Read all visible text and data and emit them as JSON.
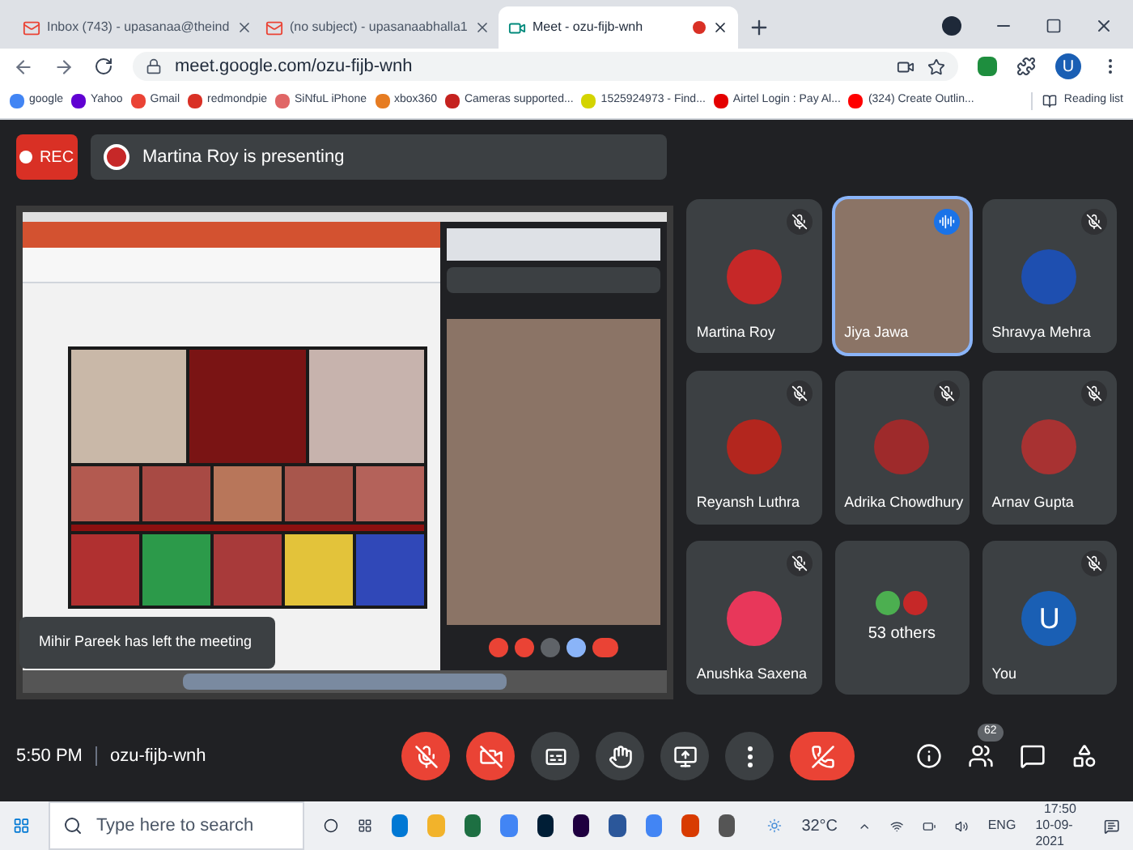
{
  "browser": {
    "tabs": [
      {
        "title": "Inbox (743) - upasanaa@theind",
        "selected": false,
        "kind": "mail"
      },
      {
        "title": "(no subject) - upasanaabhalla1",
        "selected": false,
        "kind": "mail"
      },
      {
        "title": "Meet - ozu-fijb-wnh",
        "selected": true,
        "kind": "meet",
        "recording": true
      }
    ],
    "address": "meet.google.com/ozu-fijb-wnh",
    "profile": "U",
    "bookmarks": [
      {
        "label": "google",
        "color": "#4285f4"
      },
      {
        "label": "Yahoo",
        "color": "#6001d2"
      },
      {
        "label": "Gmail",
        "color": "#ea4335"
      },
      {
        "label": "redmondpie",
        "color": "#d93025"
      },
      {
        "label": "SiNfuL iPhone",
        "color": "#e06666"
      },
      {
        "label": "xbox360",
        "color": "#e67c22"
      },
      {
        "label": "Cameras supported...",
        "color": "#c5221f"
      },
      {
        "label": "1525924973 - Find...",
        "color": "#d4d400"
      },
      {
        "label": "Airtel Login : Pay Al...",
        "color": "#e40000"
      },
      {
        "label": "(324) Create Outlin...",
        "color": "#ff0000"
      }
    ],
    "reading_list": "Reading list"
  },
  "meet": {
    "rec": "REC",
    "presenting": "Martina Roy is presenting",
    "toast": "Mihir Pareek has left the meeting",
    "tiles": [
      {
        "name": "Martina Roy",
        "kind": "avatar",
        "muted": true,
        "speaking": false,
        "color": "#c62828"
      },
      {
        "name": "Jiya Jawa",
        "kind": "video",
        "muted": false,
        "speaking": true
      },
      {
        "name": "Shravya Mehra",
        "kind": "avatar",
        "muted": true,
        "speaking": false,
        "color": "#1e4fb0"
      },
      {
        "name": "Reyansh Luthra",
        "kind": "avatar",
        "muted": true,
        "speaking": false,
        "color": "#b3261e"
      },
      {
        "name": "Adrika Chowdhury",
        "kind": "avatar",
        "muted": true,
        "speaking": false,
        "color": "#9e2a2b"
      },
      {
        "name": "Arnav Gupta",
        "kind": "avatar",
        "muted": true,
        "speaking": false,
        "color": "#a83232"
      },
      {
        "name": "Anushka Saxena",
        "kind": "avatar",
        "muted": true,
        "speaking": false,
        "color": "#e8375a"
      },
      {
        "name": "53 others",
        "kind": "group",
        "muted": false,
        "speaking": false
      },
      {
        "name": "You",
        "kind": "letter",
        "letter": "U",
        "muted": true,
        "speaking": false,
        "color": "#1a5fb4"
      }
    ],
    "time": "5:50 PM",
    "code": "ozu-fijb-wnh",
    "controls": [
      {
        "kind": "mic",
        "on": false
      },
      {
        "kind": "camera",
        "on": false
      },
      {
        "kind": "captions",
        "on": false
      },
      {
        "kind": "hand",
        "on": false
      },
      {
        "kind": "present",
        "on": false
      },
      {
        "kind": "more",
        "on": false
      },
      {
        "kind": "end"
      }
    ],
    "people_count": "62"
  },
  "taskbar": {
    "search_placeholder": "Type here to search",
    "weather": "32°C",
    "language": "ENG",
    "time": "17:50",
    "date": "10-09-2021"
  }
}
